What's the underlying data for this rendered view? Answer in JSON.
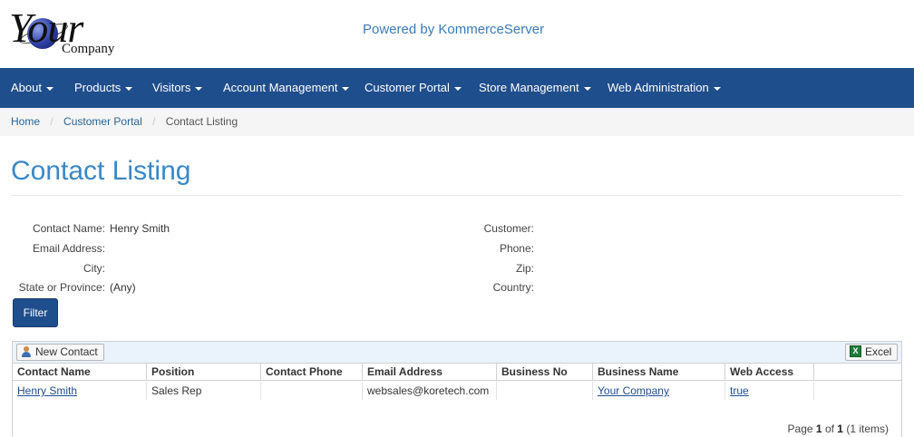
{
  "header": {
    "logo_word": "Your",
    "logo_sub": "Company",
    "powered_by": "Powered by KommerceServer"
  },
  "nav": {
    "items": [
      "About",
      "Products",
      "Visitors",
      "Account Management",
      "Customer Portal",
      "Store Management",
      "Web Administration"
    ]
  },
  "breadcrumb": {
    "home": "Home",
    "parent": "Customer Portal",
    "current": "Contact Listing",
    "separator": "/"
  },
  "page": {
    "title": "Contact Listing"
  },
  "filter": {
    "contact_name_label": "Contact Name:",
    "contact_name_value": "Henry Smith",
    "email_label": "Email Address:",
    "email_value": "",
    "city_label": "City:",
    "city_value": "",
    "state_label": "State or Province:",
    "state_value": "(Any)",
    "customer_label": "Customer:",
    "customer_value": "",
    "phone_label": "Phone:",
    "phone_value": "",
    "zip_label": "Zip:",
    "zip_value": "",
    "country_label": "Country:",
    "country_value": "",
    "button_label": "Filter"
  },
  "grid": {
    "new_contact_label": "New Contact",
    "excel_label": "Excel",
    "columns": [
      "Contact Name",
      "Position",
      "Contact Phone",
      "Email Address",
      "Business No",
      "Business Name",
      "Web Access"
    ],
    "rows": [
      {
        "contact_name": "Henry Smith",
        "position": "Sales Rep",
        "contact_phone": "",
        "email": "websales@koretech.com",
        "business_no": "",
        "business_name": "Your Company",
        "web_access": "true"
      }
    ],
    "pager": {
      "prefix": "Page",
      "page": "1",
      "of": "of",
      "total_pages": "1",
      "items": "(1 items)"
    }
  },
  "colors": {
    "navbar": "#1f4e8c",
    "title": "#3a87c4",
    "link": "#1f4e8c",
    "toolbar": "#eaf2fb"
  }
}
